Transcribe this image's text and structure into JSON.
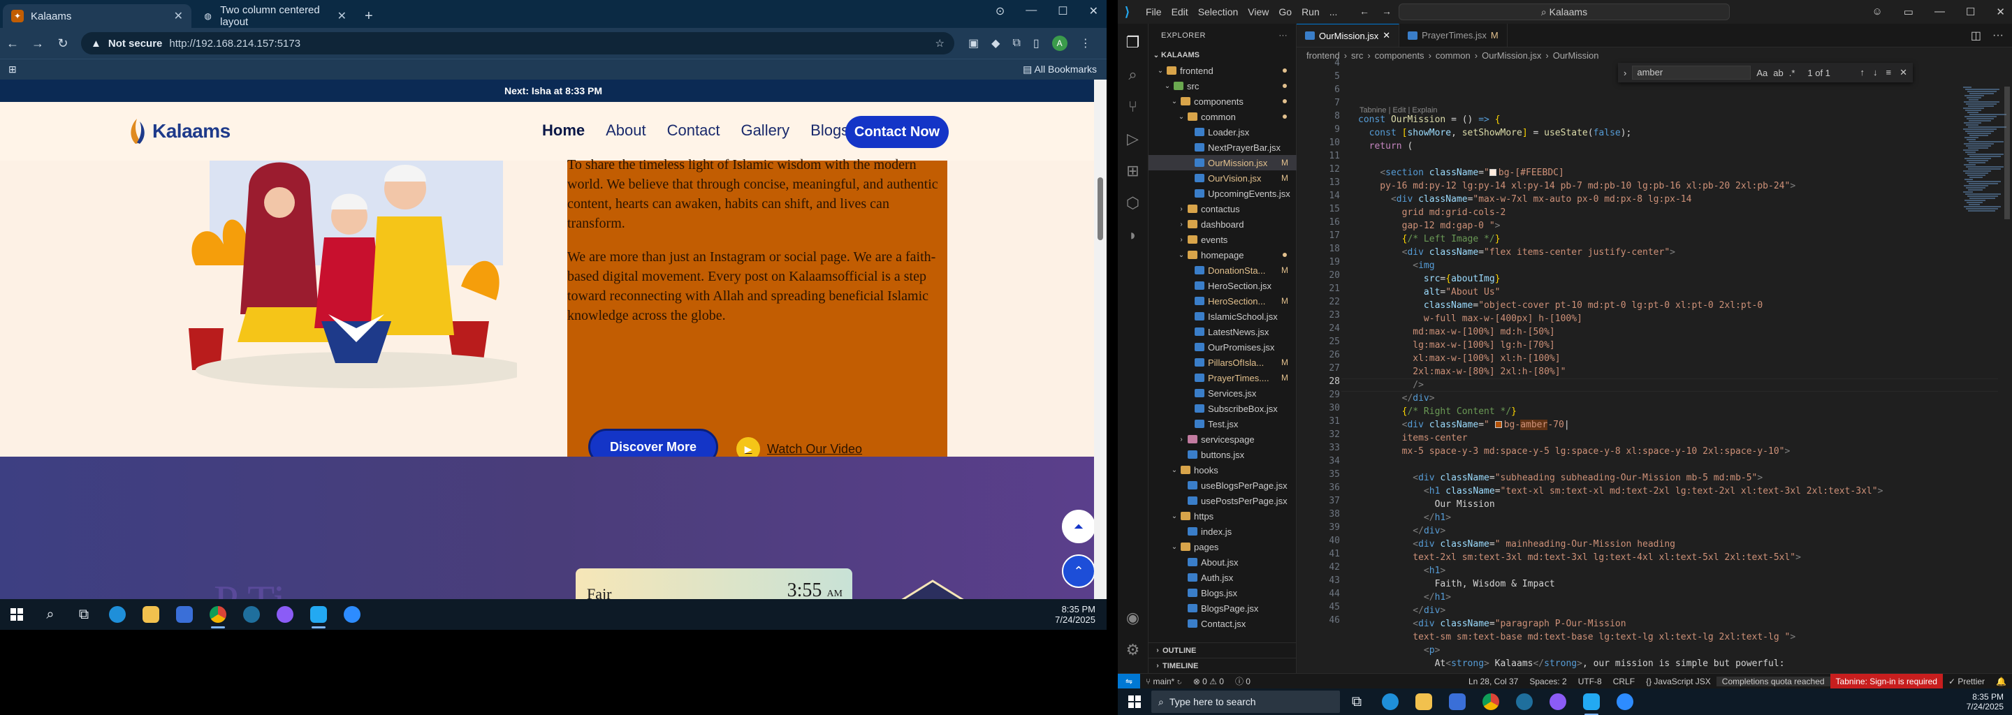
{
  "browser": {
    "tabs": [
      {
        "title": "Kalaams",
        "active": true
      },
      {
        "title": "Two column centered layout",
        "active": false
      }
    ],
    "security": "Not secure",
    "url": "http://192.168.214.157:5173",
    "all_bookmarks": "All Bookmarks"
  },
  "site": {
    "next_prayer": "Next: Isha at 8:33 PM",
    "logo_text": "Kalaams",
    "nav": [
      "Home",
      "About",
      "Contact",
      "Gallery",
      "Blogs"
    ],
    "contact_button": "Contact Now",
    "paragraph1": "To share the timeless light of Islamic wisdom with the modern world. We believe that through concise, meaningful, and authentic content, hearts can awaken, habits can shift, and lives can transform.",
    "paragraph2": "We are more than just an Instagram or social page. We are a faith-based digital movement. Every post on Kalaamsofficial is a step toward reconnecting with Allah and spreading beneficial Islamic knowledge across the globe.",
    "discover_button": "Discover More",
    "watch_link": "Watch Our Video",
    "prayer_card": {
      "name": "Fajr",
      "time": "3:55",
      "ampm": "AM"
    },
    "section_title_partial": "P     Ti"
  },
  "taskbar_left": {
    "time": "8:35 PM",
    "date": "7/24/2025"
  },
  "vscode": {
    "menu": [
      "File",
      "Edit",
      "Selection",
      "View",
      "Go",
      "Run",
      "..."
    ],
    "search": "Kalaams",
    "explorer_title": "EXPLORER",
    "workspace": "KALAAMS",
    "tree": [
      {
        "label": "frontend",
        "depth": 1,
        "type": "folder",
        "open": true,
        "dot": true
      },
      {
        "label": "src",
        "depth": 2,
        "type": "src",
        "open": true,
        "dot": true
      },
      {
        "label": "components",
        "depth": 3,
        "type": "folder",
        "open": true,
        "dot": true
      },
      {
        "label": "common",
        "depth": 4,
        "type": "folder",
        "open": true,
        "dot": true
      },
      {
        "label": "Loader.jsx",
        "depth": 5,
        "type": "jsx"
      },
      {
        "label": "NextPrayerBar.jsx",
        "depth": 5,
        "type": "jsx"
      },
      {
        "label": "OurMission.jsx",
        "depth": 5,
        "type": "jsx",
        "mod": "M",
        "sel": true
      },
      {
        "label": "OurVision.jsx",
        "depth": 5,
        "type": "jsx",
        "mod": "M"
      },
      {
        "label": "UpcomingEvents.jsx",
        "depth": 5,
        "type": "jsx"
      },
      {
        "label": "contactus",
        "depth": 4,
        "type": "folder",
        "open": false
      },
      {
        "label": "dashboard",
        "depth": 4,
        "type": "folder",
        "open": false
      },
      {
        "label": "events",
        "depth": 4,
        "type": "folder",
        "open": false
      },
      {
        "label": "homepage",
        "depth": 4,
        "type": "folder",
        "open": true,
        "dot": true
      },
      {
        "label": "DonationSta...",
        "depth": 5,
        "type": "jsx",
        "mod": "M"
      },
      {
        "label": "HeroSection.jsx",
        "depth": 5,
        "type": "jsx"
      },
      {
        "label": "HeroSection...",
        "depth": 5,
        "type": "jsx",
        "mod": "M"
      },
      {
        "label": "IslamicSchool.jsx",
        "depth": 5,
        "type": "jsx"
      },
      {
        "label": "LatestNews.jsx",
        "depth": 5,
        "type": "jsx"
      },
      {
        "label": "OurPromises.jsx",
        "depth": 5,
        "type": "jsx"
      },
      {
        "label": "PillarsOfIsla...",
        "depth": 5,
        "type": "jsx",
        "mod": "M"
      },
      {
        "label": "PrayerTimes....",
        "depth": 5,
        "type": "jsx",
        "mod": "M"
      },
      {
        "label": "Services.jsx",
        "depth": 5,
        "type": "jsx"
      },
      {
        "label": "SubscribeBox.jsx",
        "depth": 5,
        "type": "jsx"
      },
      {
        "label": "Test.jsx",
        "depth": 5,
        "type": "jsx"
      },
      {
        "label": "servicespage",
        "depth": 4,
        "type": "sp",
        "open": false
      },
      {
        "label": "buttons.jsx",
        "depth": 4,
        "type": "jsx"
      },
      {
        "label": "hooks",
        "depth": 3,
        "type": "folder",
        "open": true
      },
      {
        "label": "useBlogsPerPage.jsx",
        "depth": 4,
        "type": "jsx"
      },
      {
        "label": "usePostsPerPage.jsx",
        "depth": 4,
        "type": "jsx"
      },
      {
        "label": "https",
        "depth": 3,
        "type": "folder",
        "open": true
      },
      {
        "label": "index.js",
        "depth": 4,
        "type": "jsx"
      },
      {
        "label": "pages",
        "depth": 3,
        "type": "folder",
        "open": true
      },
      {
        "label": "About.jsx",
        "depth": 4,
        "type": "jsx"
      },
      {
        "label": "Auth.jsx",
        "depth": 4,
        "type": "jsx"
      },
      {
        "label": "Blogs.jsx",
        "depth": 4,
        "type": "jsx"
      },
      {
        "label": "BlogsPage.jsx",
        "depth": 4,
        "type": "jsx"
      },
      {
        "label": "Contact.jsx",
        "depth": 4,
        "type": "jsx"
      }
    ],
    "outline": "OUTLINE",
    "timeline": "TIMELINE",
    "editor_tabs": [
      {
        "label": "OurMission.jsx",
        "active": true,
        "mod": false
      },
      {
        "label": "PrayerTimes.jsx",
        "active": false,
        "mod": "M"
      }
    ],
    "breadcrumbs": [
      "frontend",
      "src",
      "components",
      "common",
      "OurMission.jsx",
      "OurMission"
    ],
    "find": {
      "query": "amber",
      "count": "1 of 1"
    },
    "tabnine_hint": "Tabnine | Edit | Explain",
    "line_numbers": [
      "4",
      "5",
      "6",
      "7",
      "8",
      "9",
      "10",
      "11",
      "12",
      "13",
      "14",
      "15",
      "16",
      "17",
      "18",
      "19",
      "20",
      "21",
      "22",
      "23",
      "24",
      "25",
      "26",
      "27",
      "28",
      "29",
      "30",
      "31",
      "32",
      "33",
      "34",
      "35",
      "36",
      "37",
      "38",
      "39",
      "40",
      "41",
      "42",
      "43",
      "44",
      "45",
      "46"
    ],
    "status": {
      "branch": "main*",
      "problems": "⊗ 0 ⚠ 0",
      "info": "ⓘ 0",
      "position": "Ln 28, Col 37",
      "spaces": "Spaces: 2",
      "encoding": "UTF-8",
      "eol": "CRLF",
      "language": "{} JavaScript JSX",
      "quota": "Completions quota reached",
      "tabnine": "Tabnine: Sign-in is required",
      "prettier": "✓ Prettier"
    }
  },
  "taskbar_right": {
    "search_placeholder": "Type here to search",
    "time": "8:35 PM",
    "date": "7/24/2025"
  },
  "colors": {
    "site_bg": "#fdf1e5",
    "mission_box": "#c25d02",
    "primary_blue": "#1435c7",
    "vscode_accent": "#0078d4"
  }
}
